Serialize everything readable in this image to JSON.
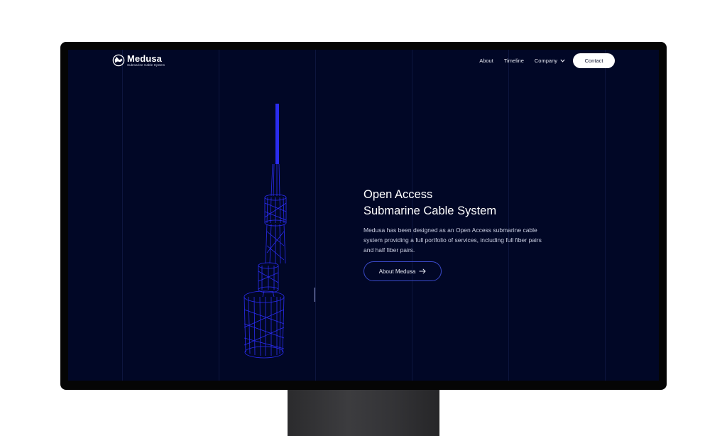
{
  "logo": {
    "title": "Medusa",
    "subtitle": "Submarine Cable System",
    "icon": "globe-logo-icon"
  },
  "nav": {
    "links": [
      "About",
      "Timeline"
    ],
    "dropdown_label": "Company",
    "dropdown_icon": "chevron-down-icon",
    "contact_label": "Contact"
  },
  "hero": {
    "title_line1": "Open Access",
    "title_line2": "Submarine Cable System",
    "description": "Medusa has been designed as an Open Access submarine cable system providing a full portfolio of services, including full fiber pairs and half fiber pairs.",
    "button_label": "About Medusa",
    "button_icon": "arrow-right-icon"
  },
  "illustration": {
    "name": "submarine-cable-wireframe"
  },
  "colors": {
    "background": "#010726",
    "accent_blue": "#2a2cf0",
    "button_border": "#3a49c8",
    "text_white": "#ffffff",
    "monitor_frame": "#050505"
  }
}
